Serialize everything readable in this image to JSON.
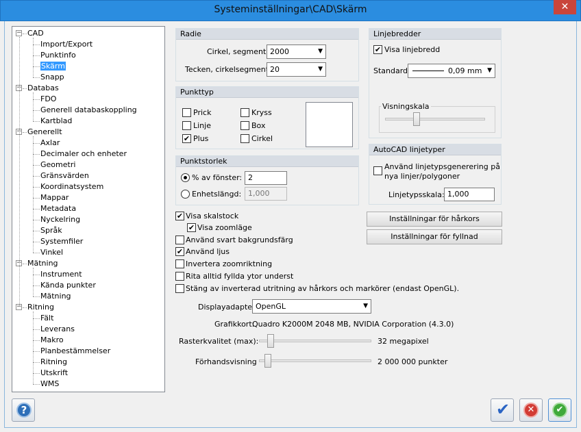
{
  "window": {
    "title": "Systeminställningar\\CAD\\Skärm",
    "close_glyph": "✕"
  },
  "tree": {
    "items": [
      {
        "label": "CAD",
        "level": 0,
        "expanded": true
      },
      {
        "label": "Import/Export",
        "level": 1
      },
      {
        "label": "Punktinfo",
        "level": 1
      },
      {
        "label": "Skärm",
        "level": 1,
        "selected": true
      },
      {
        "label": "Snapp",
        "level": 1
      },
      {
        "label": "Databas",
        "level": 0,
        "expanded": true
      },
      {
        "label": "FDO",
        "level": 1
      },
      {
        "label": "Generell databaskoppling",
        "level": 1
      },
      {
        "label": "Kartblad",
        "level": 1
      },
      {
        "label": "Generellt",
        "level": 0,
        "expanded": true
      },
      {
        "label": "Axlar",
        "level": 1
      },
      {
        "label": "Decimaler och enheter",
        "level": 1
      },
      {
        "label": "Geometri",
        "level": 1
      },
      {
        "label": "Gränsvärden",
        "level": 1
      },
      {
        "label": "Koordinatsystem",
        "level": 1
      },
      {
        "label": "Mappar",
        "level": 1
      },
      {
        "label": "Metadata",
        "level": 1
      },
      {
        "label": "Nyckelring",
        "level": 1
      },
      {
        "label": "Språk",
        "level": 1
      },
      {
        "label": "Systemfiler",
        "level": 1
      },
      {
        "label": "Vinkel",
        "level": 1
      },
      {
        "label": "Mätning",
        "level": 0,
        "expanded": true
      },
      {
        "label": "Instrument",
        "level": 1
      },
      {
        "label": "Kända punkter",
        "level": 1
      },
      {
        "label": "Mätning",
        "level": 1
      },
      {
        "label": "Ritning",
        "level": 0,
        "expanded": true
      },
      {
        "label": "Fält",
        "level": 1
      },
      {
        "label": "Leverans",
        "level": 1
      },
      {
        "label": "Makro",
        "level": 1
      },
      {
        "label": "Planbestämmelser",
        "level": 1
      },
      {
        "label": "Ritning",
        "level": 1
      },
      {
        "label": "Utskrift",
        "level": 1
      },
      {
        "label": "WMS",
        "level": 1
      }
    ]
  },
  "radie": {
    "title": "Radie",
    "cirkel_label": "Cirkel, segment:",
    "cirkel_value": "2000",
    "tecken_label": "Tecken, cirkelsegment:",
    "tecken_value": "20"
  },
  "punkttyp": {
    "title": "Punkttyp",
    "options": [
      {
        "label": "Prick",
        "checked": false
      },
      {
        "label": "Linje",
        "checked": false
      },
      {
        "label": "Plus",
        "checked": true
      },
      {
        "label": "Kryss",
        "checked": false
      },
      {
        "label": "Box",
        "checked": false
      },
      {
        "label": "Cirkel",
        "checked": false
      }
    ]
  },
  "punktstorlek": {
    "title": "Punktstorlek",
    "pct_label": "% av fönster:",
    "pct_value": "2",
    "enhet_label": "Enhetslängd:",
    "enhet_value": "1,000"
  },
  "linjebredder": {
    "title": "Linjebredder",
    "visa_label": "Visa linjebredd",
    "visa_checked": true,
    "standard_label": "Standard",
    "standard_value": "0,09 mm",
    "skala_label": "Visningskala",
    "skala_level": 0.3
  },
  "autocad": {
    "title": "AutoCAD linjetyper",
    "anvand_label_1": "Använd linjetypsgenerering på",
    "anvand_label_2": "nya linjer/polygoner",
    "anvand_checked": false,
    "skala_label": "Linjetypsskala:",
    "skala_value": "1,000"
  },
  "buttons": {
    "harkors": "Inställningar för hårkors",
    "fyllnad": "Inställningar för fyllnad"
  },
  "options": [
    {
      "label": "Visa skalstock",
      "checked": true
    },
    {
      "label": "Visa zoomläge",
      "checked": true
    },
    {
      "label": "Använd svart bakgrundsfärg",
      "checked": false
    },
    {
      "label": "Använd ljus",
      "checked": true
    },
    {
      "label": "Invertera zoomriktning",
      "checked": false
    },
    {
      "label": "Rita alltid fyllda ytor underst",
      "checked": false
    },
    {
      "label": "Stäng av inverterad utritning av hårkors och markörer (endast OpenGL).",
      "checked": false
    }
  ],
  "display": {
    "adapter_label": "Displayadapter:",
    "adapter_value": "OpenGL",
    "grafik_label": "Grafikkort:",
    "grafik_value": "Quadro K2000M 2048 MB, NVIDIA Corporation (4.3.0)",
    "raster_label": "Rasterkvalitet (max):",
    "raster_value": "32 megapixel",
    "raster_level": 0.08,
    "forhand_label": "Förhandsvisning",
    "forhand_value": "2 000 000 punkter",
    "forhand_level": 0.05
  },
  "footer": {
    "help_glyph": "?",
    "apply_glyph": "✔",
    "cancel_glyph": "✕",
    "ok_glyph": "✔"
  },
  "colors": {
    "titlebar": "#2b8de0",
    "selection": "#3399ff",
    "close": "#c9453b"
  }
}
